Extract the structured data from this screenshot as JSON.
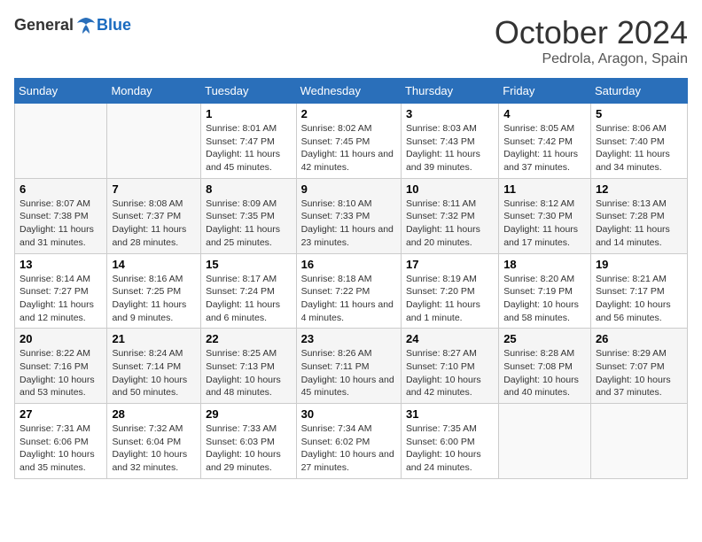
{
  "header": {
    "logo_general": "General",
    "logo_blue": "Blue",
    "month": "October 2024",
    "location": "Pedrola, Aragon, Spain"
  },
  "days_of_week": [
    "Sunday",
    "Monday",
    "Tuesday",
    "Wednesday",
    "Thursday",
    "Friday",
    "Saturday"
  ],
  "weeks": [
    [
      {
        "day": "",
        "info": ""
      },
      {
        "day": "",
        "info": ""
      },
      {
        "day": "1",
        "info": "Sunrise: 8:01 AM\nSunset: 7:47 PM\nDaylight: 11 hours and 45 minutes."
      },
      {
        "day": "2",
        "info": "Sunrise: 8:02 AM\nSunset: 7:45 PM\nDaylight: 11 hours and 42 minutes."
      },
      {
        "day": "3",
        "info": "Sunrise: 8:03 AM\nSunset: 7:43 PM\nDaylight: 11 hours and 39 minutes."
      },
      {
        "day": "4",
        "info": "Sunrise: 8:05 AM\nSunset: 7:42 PM\nDaylight: 11 hours and 37 minutes."
      },
      {
        "day": "5",
        "info": "Sunrise: 8:06 AM\nSunset: 7:40 PM\nDaylight: 11 hours and 34 minutes."
      }
    ],
    [
      {
        "day": "6",
        "info": "Sunrise: 8:07 AM\nSunset: 7:38 PM\nDaylight: 11 hours and 31 minutes."
      },
      {
        "day": "7",
        "info": "Sunrise: 8:08 AM\nSunset: 7:37 PM\nDaylight: 11 hours and 28 minutes."
      },
      {
        "day": "8",
        "info": "Sunrise: 8:09 AM\nSunset: 7:35 PM\nDaylight: 11 hours and 25 minutes."
      },
      {
        "day": "9",
        "info": "Sunrise: 8:10 AM\nSunset: 7:33 PM\nDaylight: 11 hours and 23 minutes."
      },
      {
        "day": "10",
        "info": "Sunrise: 8:11 AM\nSunset: 7:32 PM\nDaylight: 11 hours and 20 minutes."
      },
      {
        "day": "11",
        "info": "Sunrise: 8:12 AM\nSunset: 7:30 PM\nDaylight: 11 hours and 17 minutes."
      },
      {
        "day": "12",
        "info": "Sunrise: 8:13 AM\nSunset: 7:28 PM\nDaylight: 11 hours and 14 minutes."
      }
    ],
    [
      {
        "day": "13",
        "info": "Sunrise: 8:14 AM\nSunset: 7:27 PM\nDaylight: 11 hours and 12 minutes."
      },
      {
        "day": "14",
        "info": "Sunrise: 8:16 AM\nSunset: 7:25 PM\nDaylight: 11 hours and 9 minutes."
      },
      {
        "day": "15",
        "info": "Sunrise: 8:17 AM\nSunset: 7:24 PM\nDaylight: 11 hours and 6 minutes."
      },
      {
        "day": "16",
        "info": "Sunrise: 8:18 AM\nSunset: 7:22 PM\nDaylight: 11 hours and 4 minutes."
      },
      {
        "day": "17",
        "info": "Sunrise: 8:19 AM\nSunset: 7:20 PM\nDaylight: 11 hours and 1 minute."
      },
      {
        "day": "18",
        "info": "Sunrise: 8:20 AM\nSunset: 7:19 PM\nDaylight: 10 hours and 58 minutes."
      },
      {
        "day": "19",
        "info": "Sunrise: 8:21 AM\nSunset: 7:17 PM\nDaylight: 10 hours and 56 minutes."
      }
    ],
    [
      {
        "day": "20",
        "info": "Sunrise: 8:22 AM\nSunset: 7:16 PM\nDaylight: 10 hours and 53 minutes."
      },
      {
        "day": "21",
        "info": "Sunrise: 8:24 AM\nSunset: 7:14 PM\nDaylight: 10 hours and 50 minutes."
      },
      {
        "day": "22",
        "info": "Sunrise: 8:25 AM\nSunset: 7:13 PM\nDaylight: 10 hours and 48 minutes."
      },
      {
        "day": "23",
        "info": "Sunrise: 8:26 AM\nSunset: 7:11 PM\nDaylight: 10 hours and 45 minutes."
      },
      {
        "day": "24",
        "info": "Sunrise: 8:27 AM\nSunset: 7:10 PM\nDaylight: 10 hours and 42 minutes."
      },
      {
        "day": "25",
        "info": "Sunrise: 8:28 AM\nSunset: 7:08 PM\nDaylight: 10 hours and 40 minutes."
      },
      {
        "day": "26",
        "info": "Sunrise: 8:29 AM\nSunset: 7:07 PM\nDaylight: 10 hours and 37 minutes."
      }
    ],
    [
      {
        "day": "27",
        "info": "Sunrise: 7:31 AM\nSunset: 6:06 PM\nDaylight: 10 hours and 35 minutes."
      },
      {
        "day": "28",
        "info": "Sunrise: 7:32 AM\nSunset: 6:04 PM\nDaylight: 10 hours and 32 minutes."
      },
      {
        "day": "29",
        "info": "Sunrise: 7:33 AM\nSunset: 6:03 PM\nDaylight: 10 hours and 29 minutes."
      },
      {
        "day": "30",
        "info": "Sunrise: 7:34 AM\nSunset: 6:02 PM\nDaylight: 10 hours and 27 minutes."
      },
      {
        "day": "31",
        "info": "Sunrise: 7:35 AM\nSunset: 6:00 PM\nDaylight: 10 hours and 24 minutes."
      },
      {
        "day": "",
        "info": ""
      },
      {
        "day": "",
        "info": ""
      }
    ]
  ]
}
